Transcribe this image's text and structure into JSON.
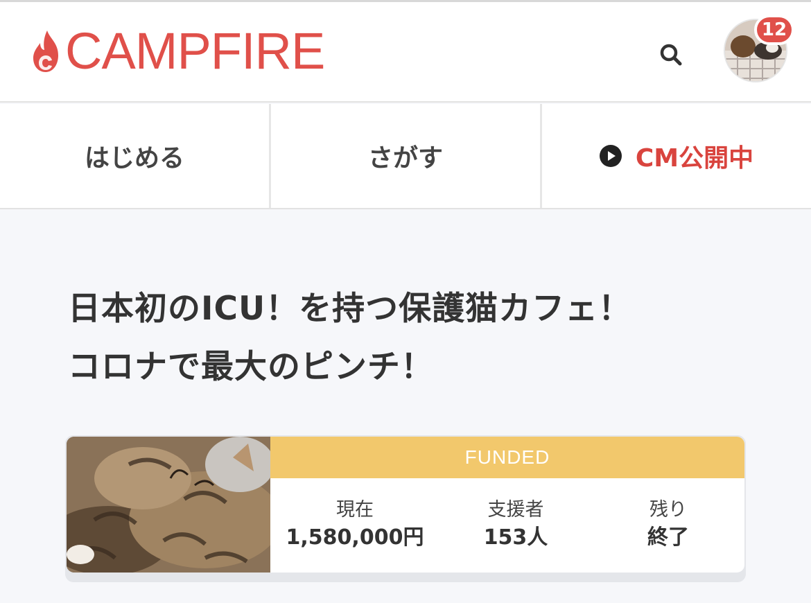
{
  "header": {
    "logo_text": "CAMPFIRE",
    "notification_count": "12"
  },
  "nav": {
    "items": [
      {
        "label": "はじめる"
      },
      {
        "label": "さがす"
      },
      {
        "label": "CM公開中"
      }
    ]
  },
  "project": {
    "title_line1": "日本初のICU！を持つ保護猫カフェ！",
    "title_line2": "コロナで最大のピンチ！",
    "status": "FUNDED",
    "stats": [
      {
        "label": "現在",
        "value": "1,580,000円"
      },
      {
        "label": "支援者",
        "value": "153人"
      },
      {
        "label": "残り",
        "value": "終了"
      }
    ]
  },
  "colors": {
    "brand": "#e0504a",
    "funded": "#f2c86c",
    "background": "#f6f7fa"
  },
  "icons": [
    "flame-icon",
    "search-icon",
    "play-icon"
  ]
}
